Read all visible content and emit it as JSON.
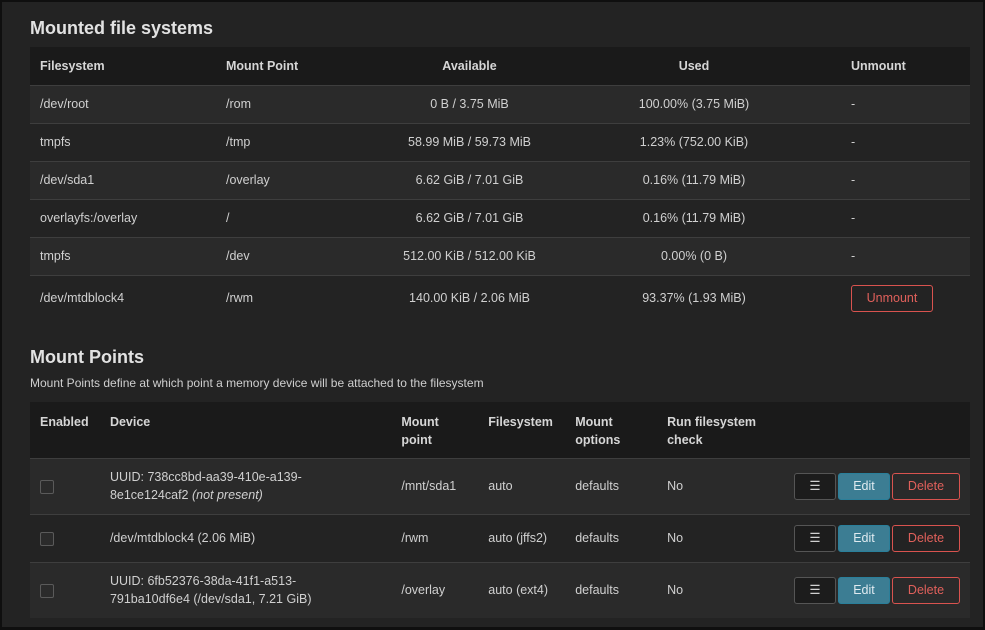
{
  "mounted": {
    "title": "Mounted file systems",
    "headers": {
      "filesystem": "Filesystem",
      "mount_point": "Mount Point",
      "available": "Available",
      "used": "Used",
      "unmount": "Unmount"
    },
    "rows": [
      {
        "filesystem": "/dev/root",
        "mount_point": "/rom",
        "available": "0 B / 3.75 MiB",
        "used": "100.00% (3.75 MiB)",
        "unmount": "-"
      },
      {
        "filesystem": "tmpfs",
        "mount_point": "/tmp",
        "available": "58.99 MiB / 59.73 MiB",
        "used": "1.23% (752.00 KiB)",
        "unmount": "-"
      },
      {
        "filesystem": "/dev/sda1",
        "mount_point": "/overlay",
        "available": "6.62 GiB / 7.01 GiB",
        "used": "0.16% (11.79 MiB)",
        "unmount": "-"
      },
      {
        "filesystem": "overlayfs:/overlay",
        "mount_point": "/",
        "available": "6.62 GiB / 7.01 GiB",
        "used": "0.16% (11.79 MiB)",
        "unmount": "-"
      },
      {
        "filesystem": "tmpfs",
        "mount_point": "/dev",
        "available": "512.00 KiB / 512.00 KiB",
        "used": "0.00% (0 B)",
        "unmount": "-"
      },
      {
        "filesystem": "/dev/mtdblock4",
        "mount_point": "/rwm",
        "available": "140.00 KiB / 2.06 MiB",
        "used": "93.37% (1.93 MiB)",
        "unmount_button": "Unmount"
      }
    ]
  },
  "mount_points": {
    "title": "Mount Points",
    "description": "Mount Points define at which point a memory device will be attached to the filesystem",
    "headers": {
      "enabled": "Enabled",
      "device": "Device",
      "mount_point_1": "Mount",
      "mount_point_2": "point",
      "filesystem": "Filesystem",
      "mount_options_1": "Mount",
      "mount_options_2": "options",
      "fsck_1": "Run filesystem",
      "fsck_2": "check"
    },
    "rows": [
      {
        "enabled": false,
        "device_line1": "UUID: 738cc8bd-aa39-410e-a139-",
        "device_line2": "8e1ce124caf2 ",
        "device_note": "(not present)",
        "mount_point": "/mnt/sda1",
        "filesystem": "auto",
        "options": "defaults",
        "fsck": "No"
      },
      {
        "enabled": false,
        "device_line1": "/dev/mtdblock4 (2.06 MiB)",
        "device_line2": "",
        "device_note": "",
        "mount_point": "/rwm",
        "filesystem": "auto (jffs2)",
        "options": "defaults",
        "fsck": "No"
      },
      {
        "enabled": false,
        "device_line1": "UUID: 6fb52376-38da-41f1-a513-",
        "device_line2": "791ba10df6e4 (/dev/sda1, 7.21 GiB)",
        "device_note": "",
        "mount_point": "/overlay",
        "filesystem": "auto (ext4)",
        "options": "defaults",
        "fsck": "No"
      }
    ],
    "buttons": {
      "menu": "☰",
      "edit": "Edit",
      "delete": "Delete"
    }
  },
  "colors": {
    "background": "#232323",
    "header_row": "#1a1a1a",
    "danger": "#d9534f",
    "edit": "#3c7d93"
  },
  "icons": [
    "menu-icon",
    "checkbox"
  ]
}
